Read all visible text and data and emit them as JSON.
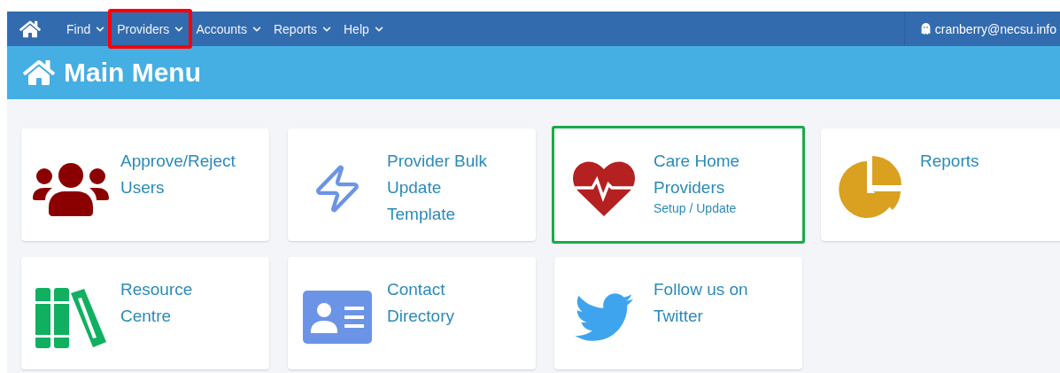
{
  "nav": {
    "items": [
      {
        "label": "Find",
        "highlighted": false
      },
      {
        "label": "Providers",
        "highlighted": true,
        "color": "#ff0000"
      },
      {
        "label": "Accounts",
        "highlighted": false
      },
      {
        "label": "Reports",
        "highlighted": false
      },
      {
        "label": "Help",
        "highlighted": false
      }
    ],
    "user": "cranberry@necsu.info"
  },
  "header": {
    "title": "Main Menu"
  },
  "tiles": [
    {
      "kind": "users",
      "lines": [
        "Approve/Reject",
        "Users"
      ],
      "highlighted": false
    },
    {
      "kind": "bolt",
      "lines": [
        "Provider Bulk",
        "Update",
        "Template"
      ],
      "highlighted": false
    },
    {
      "kind": "heart",
      "lines": [
        "Care Home",
        "Providers"
      ],
      "subtitle": "Setup / Update",
      "highlighted": true,
      "color": "#1aaa4a"
    },
    {
      "kind": "pie",
      "lines": [
        "Reports"
      ],
      "highlighted": false
    },
    {
      "kind": "books",
      "lines": [
        "Resource",
        "Centre"
      ],
      "highlighted": false
    },
    {
      "kind": "contact",
      "lines": [
        "Contact",
        "Directory"
      ],
      "highlighted": false
    },
    {
      "kind": "twitter",
      "lines": [
        "Follow us on",
        "Twitter"
      ],
      "highlighted": false
    }
  ]
}
